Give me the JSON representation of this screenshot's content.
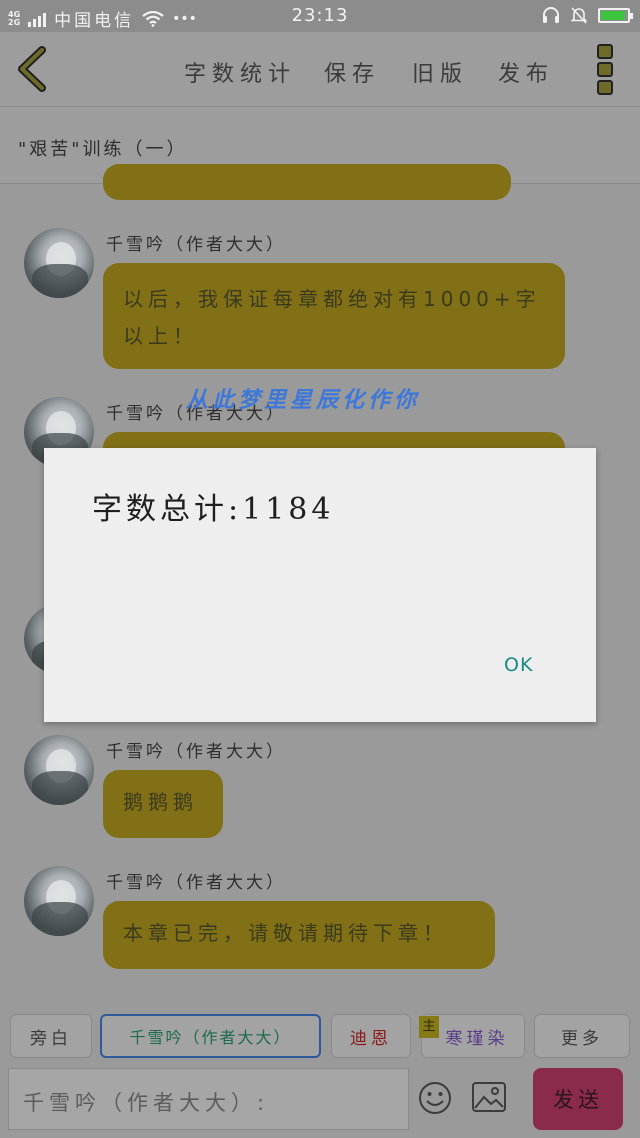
{
  "status_bar": {
    "network_top": "4G",
    "network_bottom": "2G",
    "carrier": "中国电信",
    "wifi_icon": "wifi-icon",
    "more": "•••",
    "time": "23:13",
    "headphone_icon": "headphone-icon",
    "mute_icon": "bell-muted-icon",
    "battery_icon": "battery-charging-icon"
  },
  "toolbar": {
    "back_icon": "chevron-left-icon",
    "word_count": "字数统计",
    "save": "保存",
    "old_version": "旧版",
    "publish": "发布",
    "menu_icon": "more-vertical-icon"
  },
  "chapter_title": "\"艰苦\"训练（一）",
  "messages": [
    {
      "sender": "千雪吟（作者大大）",
      "text": "以后，我保证每章都绝对有1000+字以上！"
    },
    {
      "sender": "千雪吟（作者大大）",
      "text": ""
    },
    {
      "sender": "千雪吟（作者大大）",
      "text": "鹅鹅鹅"
    },
    {
      "sender": "千雪吟（作者大大）",
      "text": "本章已完，请敬请期待下章！"
    }
  ],
  "watermark": "从此梦里星辰化作你",
  "dialog": {
    "message": "字数总计:1184",
    "ok": "OK"
  },
  "roles": {
    "narrator": "旁白",
    "author": "千雪吟（作者大大）",
    "dien": "迪恩",
    "main_badge": "主",
    "hanjinran": "寒瑾染",
    "more": "更多"
  },
  "input": {
    "placeholder": "千雪吟（作者大大）:",
    "emoji_icon": "emoji-icon",
    "image_icon": "image-icon",
    "send": "发送"
  },
  "colors": {
    "bubble": "#827016",
    "dialog_ok": "#1a8a86",
    "send_button": "#8a2b4c",
    "watermark": "#3d78d9"
  }
}
